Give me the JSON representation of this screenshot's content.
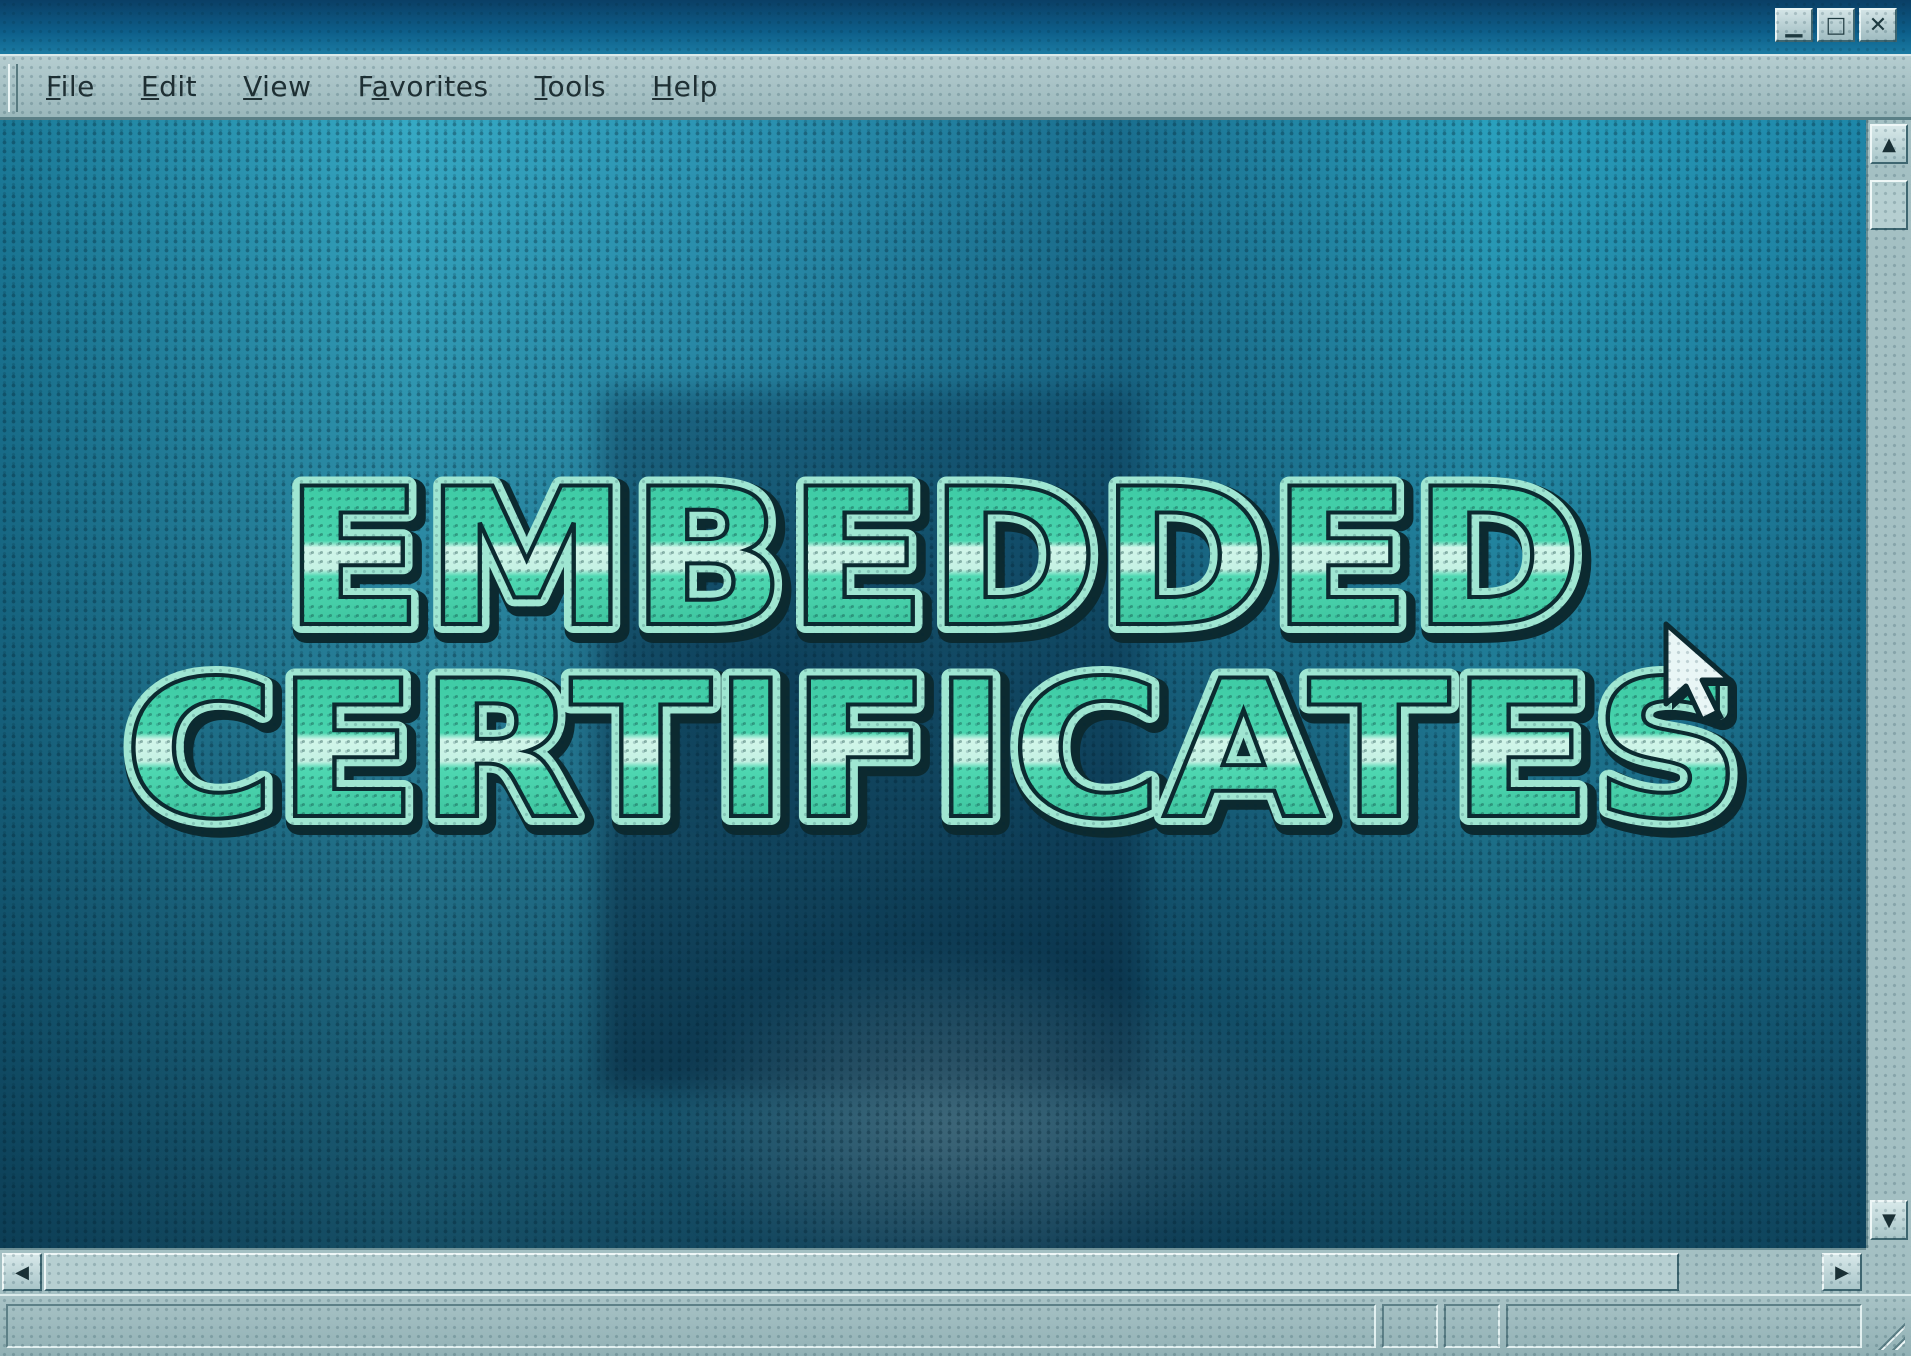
{
  "window": {
    "controls": {
      "minimize_icon": "minimize-icon",
      "maximize_icon": "maximize-icon",
      "close_icon": "close-icon"
    }
  },
  "menubar": {
    "items": [
      {
        "label": "File",
        "accel": "F",
        "rest": "ile"
      },
      {
        "label": "Edit",
        "accel": "E",
        "rest": "dit"
      },
      {
        "label": "View",
        "accel": "V",
        "rest": "iew"
      },
      {
        "label": "Favorites",
        "pre": "F",
        "accel": "a",
        "rest": "vorites"
      },
      {
        "label": "Tools",
        "accel": "T",
        "rest": "ools"
      },
      {
        "label": "Help",
        "accel": "H",
        "rest": "elp"
      }
    ]
  },
  "content": {
    "headline_line1": "EMBEDDED",
    "headline_line2": "CERTIFICATES"
  },
  "icons": {
    "pointer": "mouse-pointer-icon",
    "scroll_up": "arrow-up-icon",
    "scroll_down": "arrow-down-icon",
    "scroll_left": "arrow-left-icon",
    "scroll_right": "arrow-right-icon",
    "resize_grip": "resize-grip-icon"
  },
  "colors": {
    "title_fill": "#3fcfa6",
    "title_highlight": "#c9f3e6",
    "title_outline": "#0c2a30"
  }
}
